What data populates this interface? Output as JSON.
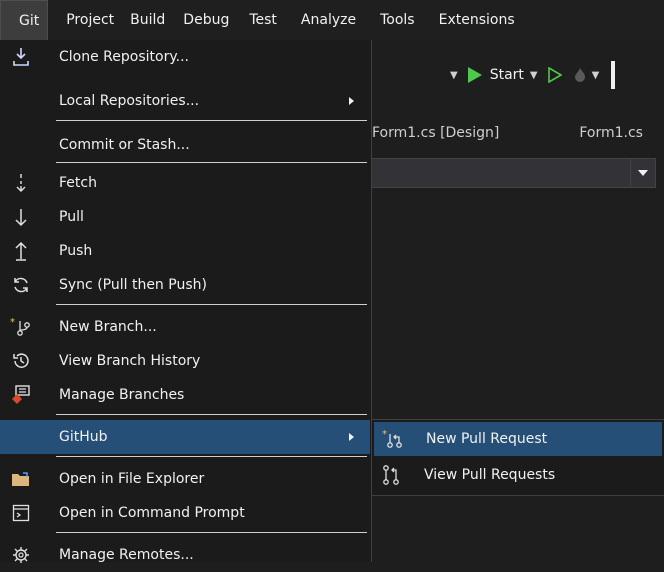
{
  "menubar": {
    "items": [
      "Git",
      "Project",
      "Build",
      "Debug",
      "Test",
      "Analyze",
      "Tools",
      "Extensions"
    ]
  },
  "toolbar": {
    "start_label": "Start"
  },
  "tabs": [
    "Form1.cs [Design]",
    "Form1.cs"
  ],
  "git_menu": {
    "items": [
      {
        "label": "Clone Repository...",
        "icon": "download-icon"
      },
      {
        "label": "Local Repositories...",
        "icon": ""
      },
      {
        "label": "Commit or Stash...",
        "icon": ""
      },
      {
        "label": "Fetch",
        "icon": "fetch-icon"
      },
      {
        "label": "Pull",
        "icon": "pull-arrow-icon"
      },
      {
        "label": "Push",
        "icon": "push-arrow-icon"
      },
      {
        "label": "Sync (Pull then Push)",
        "icon": "sync-icon"
      },
      {
        "label": "New Branch...",
        "icon": "new-branch-icon"
      },
      {
        "label": "View Branch History",
        "icon": "history-icon"
      },
      {
        "label": "Manage Branches",
        "icon": "manage-branches-icon"
      },
      {
        "label": "GitHub",
        "icon": ""
      },
      {
        "label": "Open in File Explorer",
        "icon": "folder-icon"
      },
      {
        "label": "Open in Command Prompt",
        "icon": "terminal-icon"
      },
      {
        "label": "Manage Remotes...",
        "icon": "gear-icon"
      }
    ]
  },
  "github_submenu": {
    "items": [
      {
        "label": "New Pull Request",
        "icon": "new-pull-request-icon"
      },
      {
        "label": "View Pull Requests",
        "icon": "pull-request-icon"
      }
    ]
  },
  "colors": {
    "menu_bg": "#1b1b1c",
    "highlight": "#264f78",
    "start_green": "#4ec94b"
  }
}
